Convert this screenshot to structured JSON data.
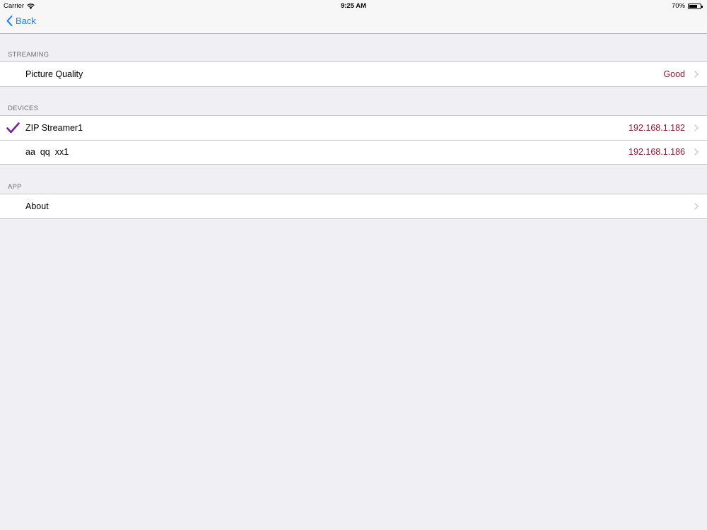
{
  "status_bar": {
    "carrier": "Carrier",
    "time": "9:25 AM",
    "battery_text": "70%",
    "battery_level": 0.7
  },
  "nav": {
    "back_label": "Back"
  },
  "colors": {
    "accent": "#157efb",
    "value_text": "#8e1b34",
    "checkmark": "#7a1fa2"
  },
  "sections": {
    "streaming": {
      "header": "STREAMING",
      "rows": [
        {
          "label": "Picture Quality",
          "value": "Good"
        }
      ]
    },
    "devices": {
      "header": "DEVICES",
      "rows": [
        {
          "label": "ZIP Streamer1",
          "value": "192.168.1.182",
          "selected": true
        },
        {
          "label": "aa  qq  xx1",
          "value": "192.168.1.186",
          "selected": false
        }
      ]
    },
    "app": {
      "header": "APP",
      "rows": [
        {
          "label": "About",
          "value": ""
        }
      ]
    }
  }
}
